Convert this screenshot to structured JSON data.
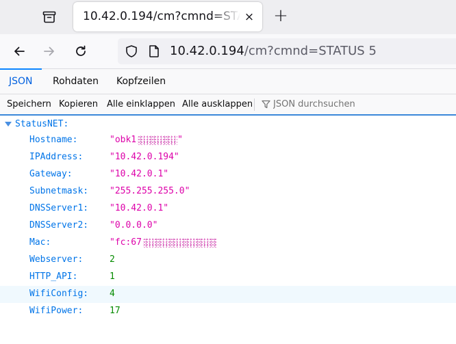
{
  "browser": {
    "tab": {
      "title": "10.42.0.194/cm?cmnd=STATUS 5",
      "close_symbol": "×"
    },
    "new_tab_symbol": "+",
    "url": {
      "host": "10.42.0.194",
      "path": "/cm?cmnd=STATUS 5"
    }
  },
  "viewer": {
    "tabs": [
      {
        "label": "JSON",
        "active": true
      },
      {
        "label": "Rohdaten",
        "active": false
      },
      {
        "label": "Kopfzeilen",
        "active": false
      }
    ],
    "toolbar": {
      "save": "Speichern",
      "copy": "Kopieren",
      "collapse_all": "Alle einklappen",
      "expand_all": "Alle ausklappen",
      "filter_placeholder": "JSON durchsuchen"
    }
  },
  "json": {
    "root_key": "StatusNET:",
    "rows": [
      {
        "key": "Hostname:",
        "value": "\"obk1",
        "value_end": "\"",
        "redacted": true,
        "type": "string"
      },
      {
        "key": "IPAddress:",
        "value": "\"10.42.0.194\"",
        "type": "string"
      },
      {
        "key": "Gateway:",
        "value": "\"10.42.0.1\"",
        "type": "string"
      },
      {
        "key": "Subnetmask:",
        "value": "\"255.255.255.0\"",
        "type": "string"
      },
      {
        "key": "DNSServer1:",
        "value": "\"10.42.0.1\"",
        "type": "string"
      },
      {
        "key": "DNSServer2:",
        "value": "\"0.0.0.0\"",
        "type": "string"
      },
      {
        "key": "Mac:",
        "value": "\"fc:67",
        "value_end": "",
        "redacted": true,
        "type": "string"
      },
      {
        "key": "Webserver:",
        "value": "2",
        "type": "number"
      },
      {
        "key": "HTTP_API:",
        "value": "1",
        "type": "number"
      },
      {
        "key": "WifiConfig:",
        "value": "4",
        "type": "number",
        "highlighted": true
      },
      {
        "key": "WifiPower:",
        "value": "17",
        "type": "number"
      }
    ]
  },
  "colors": {
    "key": "#0074e8",
    "string": "#dd00a9",
    "number": "#058b00",
    "accent": "#0a84ff"
  }
}
